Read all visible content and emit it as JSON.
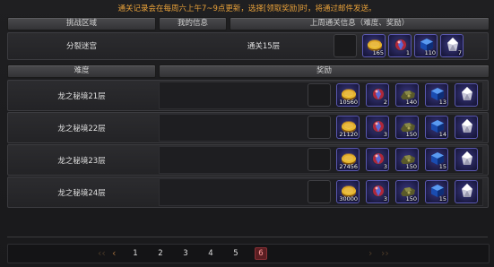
{
  "notice": "通关记录会在每周六上午7~9点更新，选择[领取奖励]时，将通过邮件发送。",
  "headers": {
    "challenge_area": "挑战区域",
    "my_info": "我的信息",
    "last_week_info": "上周通关信息（难度、奖励）",
    "difficulty": "难度",
    "reward": "奖励"
  },
  "summary": {
    "area": "分裂迷宫",
    "my_info": "通关15层",
    "items": [
      {
        "icon": "gold-coin-icon",
        "count": "165"
      },
      {
        "icon": "red-orb-icon",
        "count": "1"
      },
      {
        "icon": "blue-cube-icon",
        "count": "110"
      },
      {
        "icon": "white-crystal-icon",
        "count": "7"
      }
    ]
  },
  "rows": [
    {
      "name": "龙之秘境21层",
      "items": [
        {
          "icon": "gold-coin-icon",
          "count": "10560"
        },
        {
          "icon": "red-orb-icon",
          "count": "2"
        },
        {
          "icon": "olive-ore-icon",
          "count": "140"
        },
        {
          "icon": "blue-cube-icon",
          "count": "13"
        },
        {
          "icon": "white-crystal-icon",
          "count": ""
        }
      ]
    },
    {
      "name": "龙之秘境22层",
      "items": [
        {
          "icon": "gold-coin-icon",
          "count": "21120"
        },
        {
          "icon": "red-orb-icon",
          "count": "3"
        },
        {
          "icon": "olive-ore-icon",
          "count": "150"
        },
        {
          "icon": "blue-cube-icon",
          "count": "14"
        },
        {
          "icon": "white-crystal-icon",
          "count": ""
        }
      ]
    },
    {
      "name": "龙之秘境23层",
      "items": [
        {
          "icon": "gold-coin-icon",
          "count": "27456"
        },
        {
          "icon": "red-orb-icon",
          "count": "3"
        },
        {
          "icon": "olive-ore-icon",
          "count": "150"
        },
        {
          "icon": "blue-cube-icon",
          "count": "15"
        },
        {
          "icon": "white-crystal-icon",
          "count": ""
        }
      ]
    },
    {
      "name": "龙之秘境24层",
      "items": [
        {
          "icon": "gold-coin-icon",
          "count": "30000"
        },
        {
          "icon": "red-orb-icon",
          "count": "3"
        },
        {
          "icon": "olive-ore-icon",
          "count": "150"
        },
        {
          "icon": "blue-cube-icon",
          "count": "15"
        },
        {
          "icon": "white-crystal-icon",
          "count": ""
        }
      ]
    }
  ],
  "pager": {
    "pages": [
      "1",
      "2",
      "3",
      "4",
      "5",
      "6"
    ],
    "current": "6",
    "first_icon": "double-chevron-left-icon",
    "prev_icon": "chevron-left-icon",
    "next_icon": "chevron-right-icon",
    "last_icon": "double-chevron-right-icon"
  },
  "colors": {
    "notice": "#e8a13a",
    "item_border": "#5a58b0",
    "current_page": "#5a1e22"
  }
}
